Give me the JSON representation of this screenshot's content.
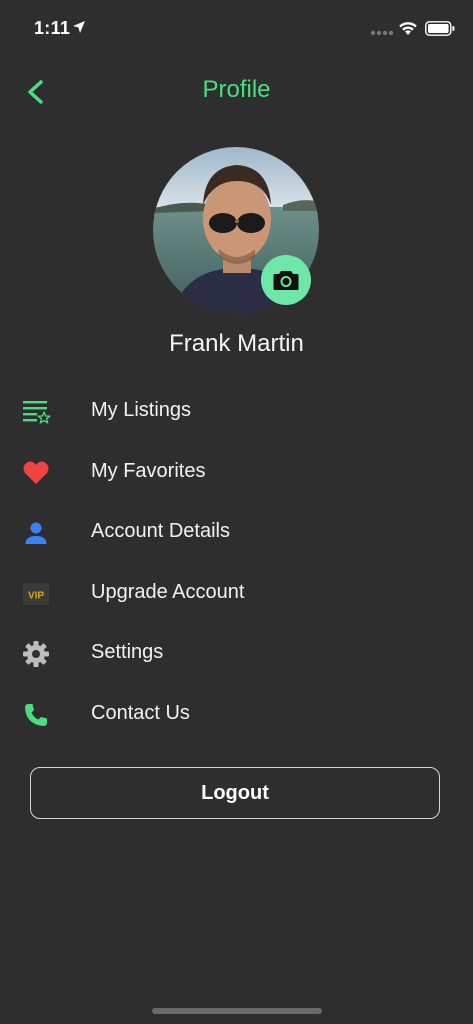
{
  "status_bar": {
    "time": "1:11"
  },
  "header": {
    "title": "Profile"
  },
  "profile": {
    "name": "Frank Martin"
  },
  "menu": {
    "items": [
      {
        "label": "My Listings",
        "icon": "listings-star-icon",
        "color": "#4ade80"
      },
      {
        "label": "My Favorites",
        "icon": "heart-icon",
        "color": "#ef4444"
      },
      {
        "label": "Account Details",
        "icon": "person-icon",
        "color": "#3b82f6"
      },
      {
        "label": "Upgrade Account",
        "icon": "vip-icon",
        "icon_text": "VIP",
        "color": "#e0a800"
      },
      {
        "label": "Settings",
        "icon": "gear-icon",
        "color": "#bdbdbd"
      },
      {
        "label": "Contact Us",
        "icon": "phone-icon",
        "color": "#4ade80"
      }
    ]
  },
  "logout": {
    "label": "Logout"
  },
  "colors": {
    "accent": "#4ade80",
    "background": "#2e2e2e",
    "camera_button": "#6ee7a7"
  }
}
